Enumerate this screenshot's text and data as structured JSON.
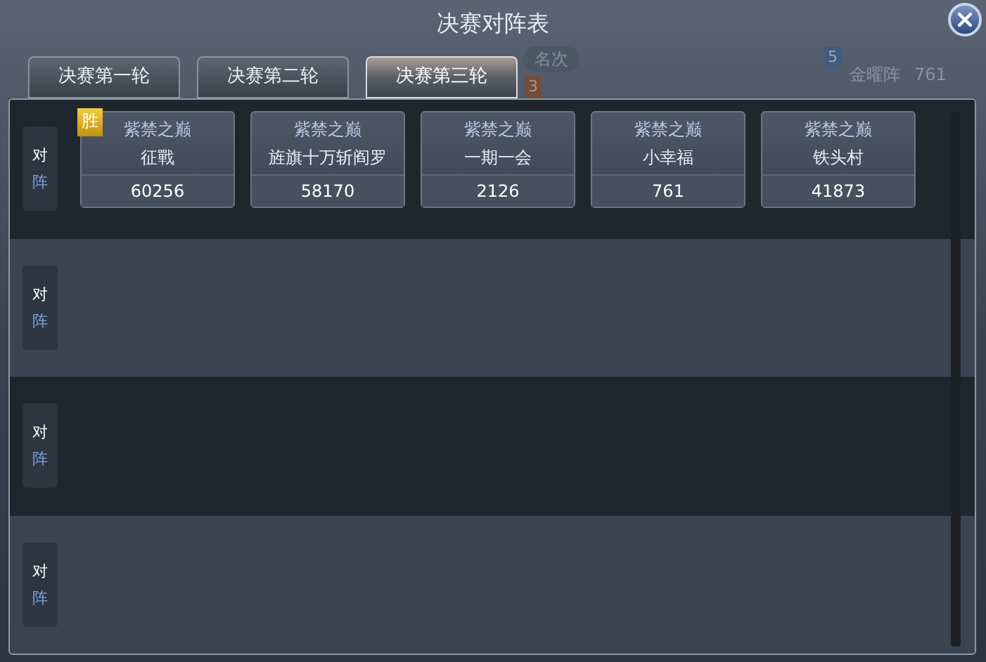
{
  "title": "决赛对阵表",
  "background": {
    "rank_button": "名次",
    "rank_badges": [
      "5",
      "3"
    ],
    "team_name": "金曜阵",
    "team_score": "761"
  },
  "tabs": [
    {
      "label": "决赛第一轮",
      "selected": false
    },
    {
      "label": "决赛第二轮",
      "selected": false
    },
    {
      "label": "决赛第三轮",
      "selected": true
    }
  ],
  "rows": [
    {
      "label": [
        "对",
        "阵"
      ],
      "teams": [
        {
          "server": "紫禁之巅",
          "name": "征戰",
          "score": "60256",
          "winner": true
        },
        {
          "server": "紫禁之巅",
          "name": "旌旗十万斩阎罗",
          "score": "58170",
          "winner": false
        },
        {
          "server": "紫禁之巅",
          "name": "一期一会",
          "score": "2126",
          "winner": false
        },
        {
          "server": "紫禁之巅",
          "name": "小幸福",
          "score": "761",
          "winner": false
        },
        {
          "server": "紫禁之巅",
          "name": "铁头村",
          "score": "41873",
          "winner": false
        }
      ],
      "winner_mark": "胜"
    },
    {
      "label": [
        "对",
        "阵"
      ],
      "teams": []
    },
    {
      "label": [
        "对",
        "阵"
      ],
      "teams": []
    },
    {
      "label": [
        "对",
        "阵"
      ],
      "teams": []
    }
  ]
}
